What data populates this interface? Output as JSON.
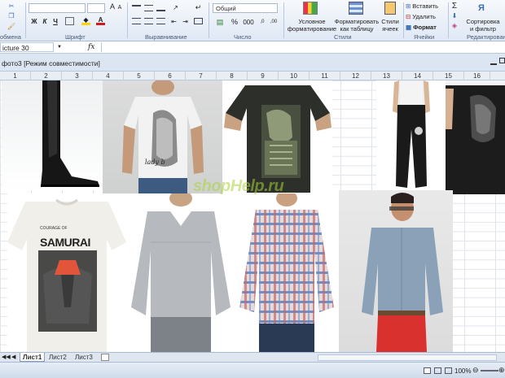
{
  "ribbon": {
    "font_group": "Шрифт",
    "align_group": "Выравнивание",
    "number_group": "Число",
    "styles_group": "Стили",
    "cells_group": "Ячейки",
    "edit_group": "Редактирован",
    "clipboard_group": "обмена",
    "number_format": "Общий",
    "cond_format": "Условное форматирование",
    "cond_format_l1": "Условное",
    "cond_format_l2": "форматирование",
    "format_table_l1": "Форматировать",
    "format_table_l2": "как таблицу",
    "cell_styles_l1": "Стили",
    "cell_styles_l2": "ячеек",
    "insert": "Вставить",
    "delete": "Удалить",
    "format": "Формат",
    "sort_l1": "Сортировка",
    "sort_l2": "и фильтр",
    "bold": "Ж",
    "italic": "К",
    "underline": "Ч"
  },
  "formula_bar": {
    "name_box": "icture 30",
    "fx": "fx"
  },
  "window": {
    "title": "фото3  [Режим совместимости]"
  },
  "columns": [
    "1",
    "2",
    "3",
    "4",
    "5",
    "6",
    "7",
    "8",
    "9",
    "10",
    "11",
    "12",
    "13",
    "14",
    "15",
    "16"
  ],
  "sheets": [
    "Лист1",
    "Лист2",
    "Лист3"
  ],
  "status": {
    "zoom": "100%"
  },
  "watermark": "shopHelp.ru",
  "tshirt_text": {
    "samurai_top": "COURAGE OF",
    "samurai": "SAMURAI",
    "lady": "lady b"
  },
  "colors": {
    "ribbon_bg": "#dfe8f5",
    "grid_line": "#dfe4ea",
    "accent": "#3b6eb4"
  }
}
